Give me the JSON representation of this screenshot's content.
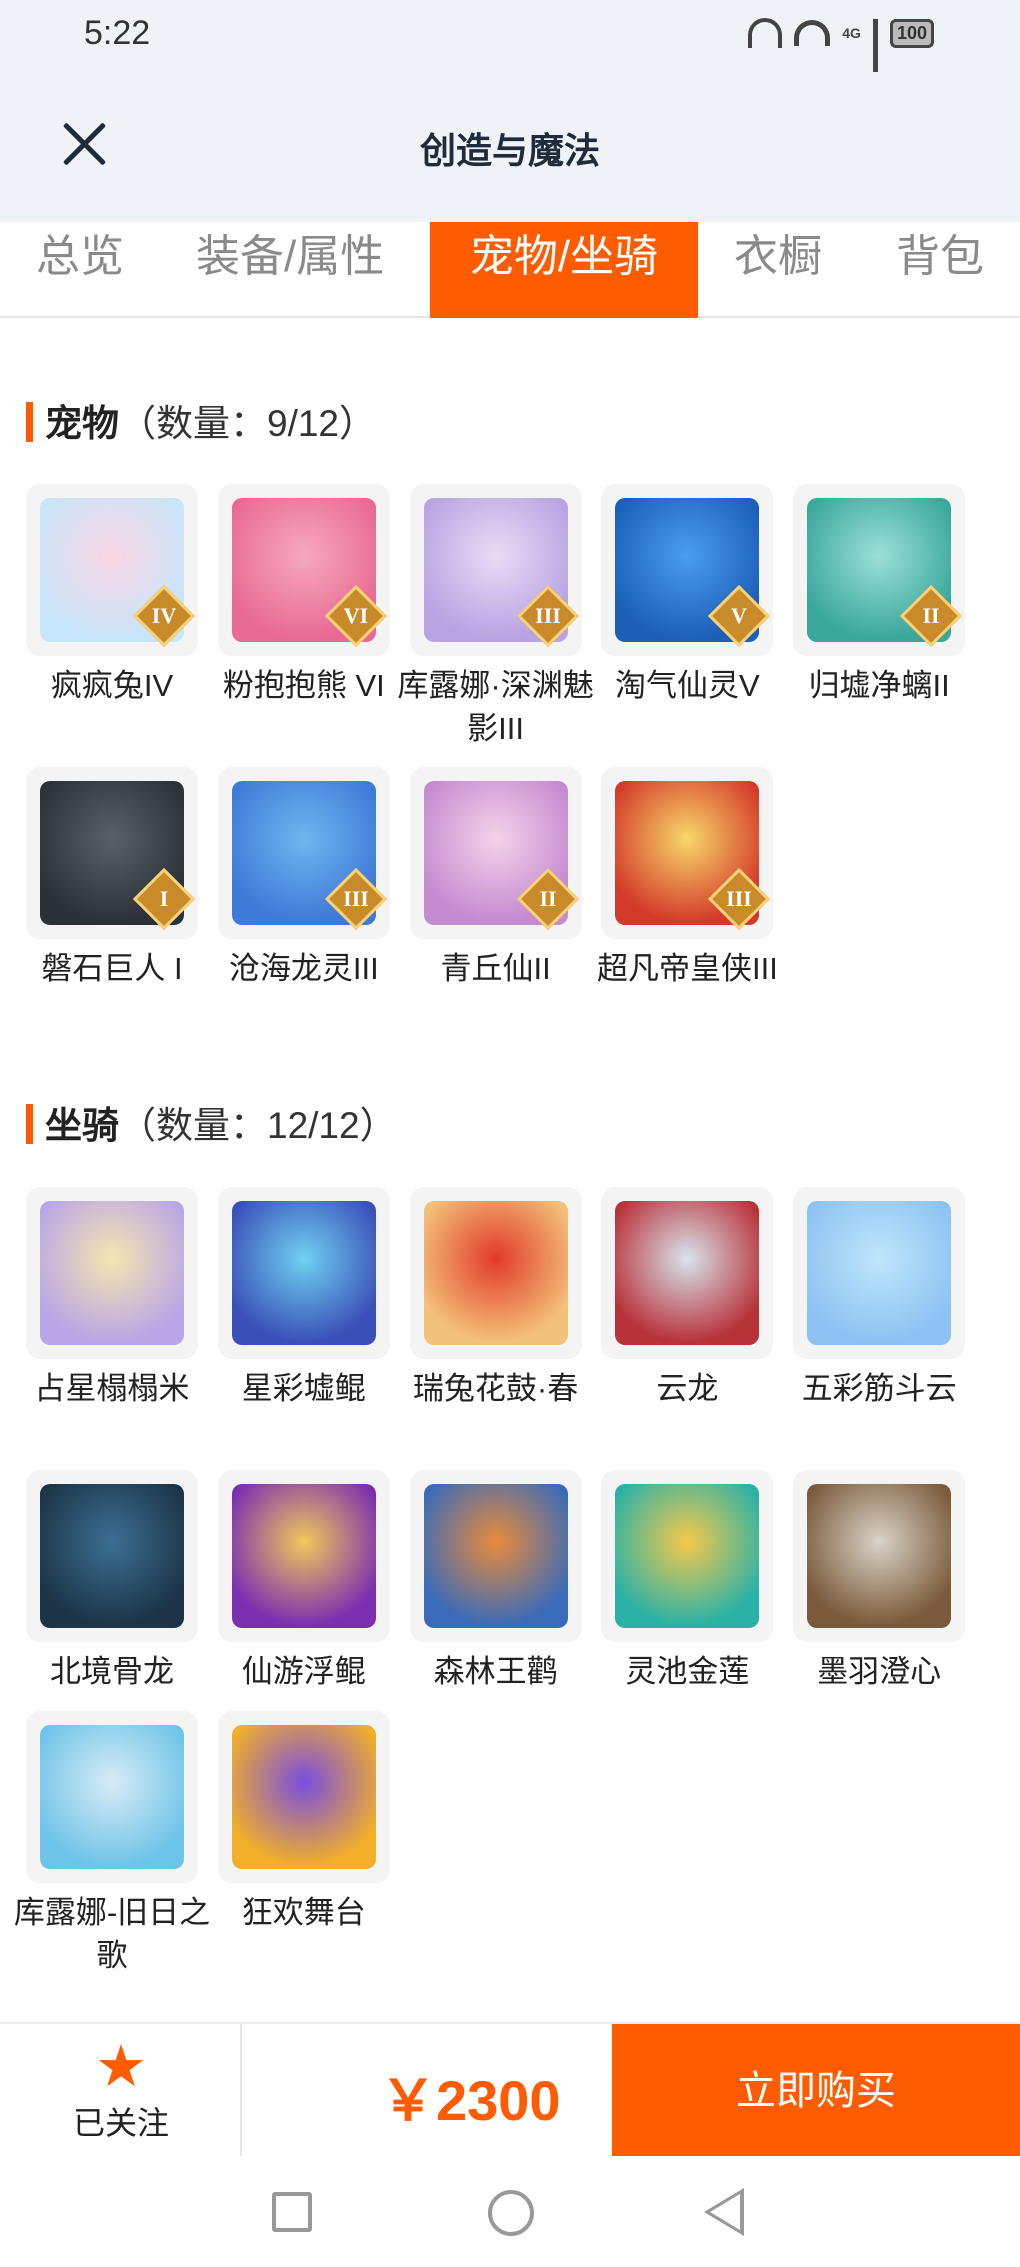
{
  "status_bar": {
    "time": "5:22",
    "network": "4G",
    "battery": "100"
  },
  "header": {
    "title": "创造与魔法"
  },
  "tabs": [
    {
      "label": "总览"
    },
    {
      "label": "装备/属性"
    },
    {
      "label": "宠物/坐骑"
    },
    {
      "label": "衣橱"
    },
    {
      "label": "背包"
    }
  ],
  "active_tab": "宠物/坐骑",
  "pets": {
    "title": "宠物",
    "count": "（数量：9/12）",
    "items": [
      {
        "name": "疯疯兔IV",
        "badge": "IV",
        "icon": "pink-rabbit-pet"
      },
      {
        "name": "粉抱抱熊 VI",
        "badge": "VI",
        "icon": "pink-bear-pet"
      },
      {
        "name": "库露娜·深渊魅影III",
        "badge": "III",
        "icon": "white-haired-girl-pet"
      },
      {
        "name": "淘气仙灵V",
        "badge": "V",
        "icon": "blue-dog-pet"
      },
      {
        "name": "归墟净螭II",
        "badge": "II",
        "icon": "teal-dragon-pet"
      },
      {
        "name": "磐石巨人 I",
        "badge": "I",
        "icon": "stone-golem-pet"
      },
      {
        "name": "沧海龙灵III",
        "badge": "III",
        "icon": "blue-dragon-boy-pet"
      },
      {
        "name": "青丘仙II",
        "badge": "II",
        "icon": "fox-fairy-pet"
      },
      {
        "name": "超凡帝皇侠III",
        "badge": "III",
        "icon": "golden-armor-pet"
      }
    ]
  },
  "mounts": {
    "title": "坐骑",
    "count": "（数量：12/12）",
    "items": [
      {
        "name": "占星榻榻米",
        "icon": "golden-lantern-mount"
      },
      {
        "name": "星彩墟鲲",
        "icon": "starry-whale-mount"
      },
      {
        "name": "瑞兔花鼓·春",
        "icon": "red-drum-mount"
      },
      {
        "name": "云龙",
        "icon": "red-dragon-mount"
      },
      {
        "name": "五彩筋斗云",
        "icon": "cloud-mount"
      },
      {
        "name": "北境骨龙",
        "icon": "bone-dragon-mount"
      },
      {
        "name": "仙游浮鲲",
        "icon": "purple-fish-mount"
      },
      {
        "name": "森林王鹳",
        "icon": "stork-mount"
      },
      {
        "name": "灵池金莲",
        "icon": "golden-lotus-mount"
      },
      {
        "name": "墨羽澄心",
        "icon": "feather-sword-mount"
      },
      {
        "name": "库露娜-旧日之歌",
        "icon": "cloud-girl-mount"
      },
      {
        "name": "狂欢舞台",
        "icon": "heart-stage-mount"
      }
    ]
  },
  "footer": {
    "follow_label": "已关注",
    "price": "￥2300",
    "buy_label": "立即购买"
  },
  "colors": {
    "accent": "#ff5b00",
    "header_bg": "#eff3f8"
  }
}
